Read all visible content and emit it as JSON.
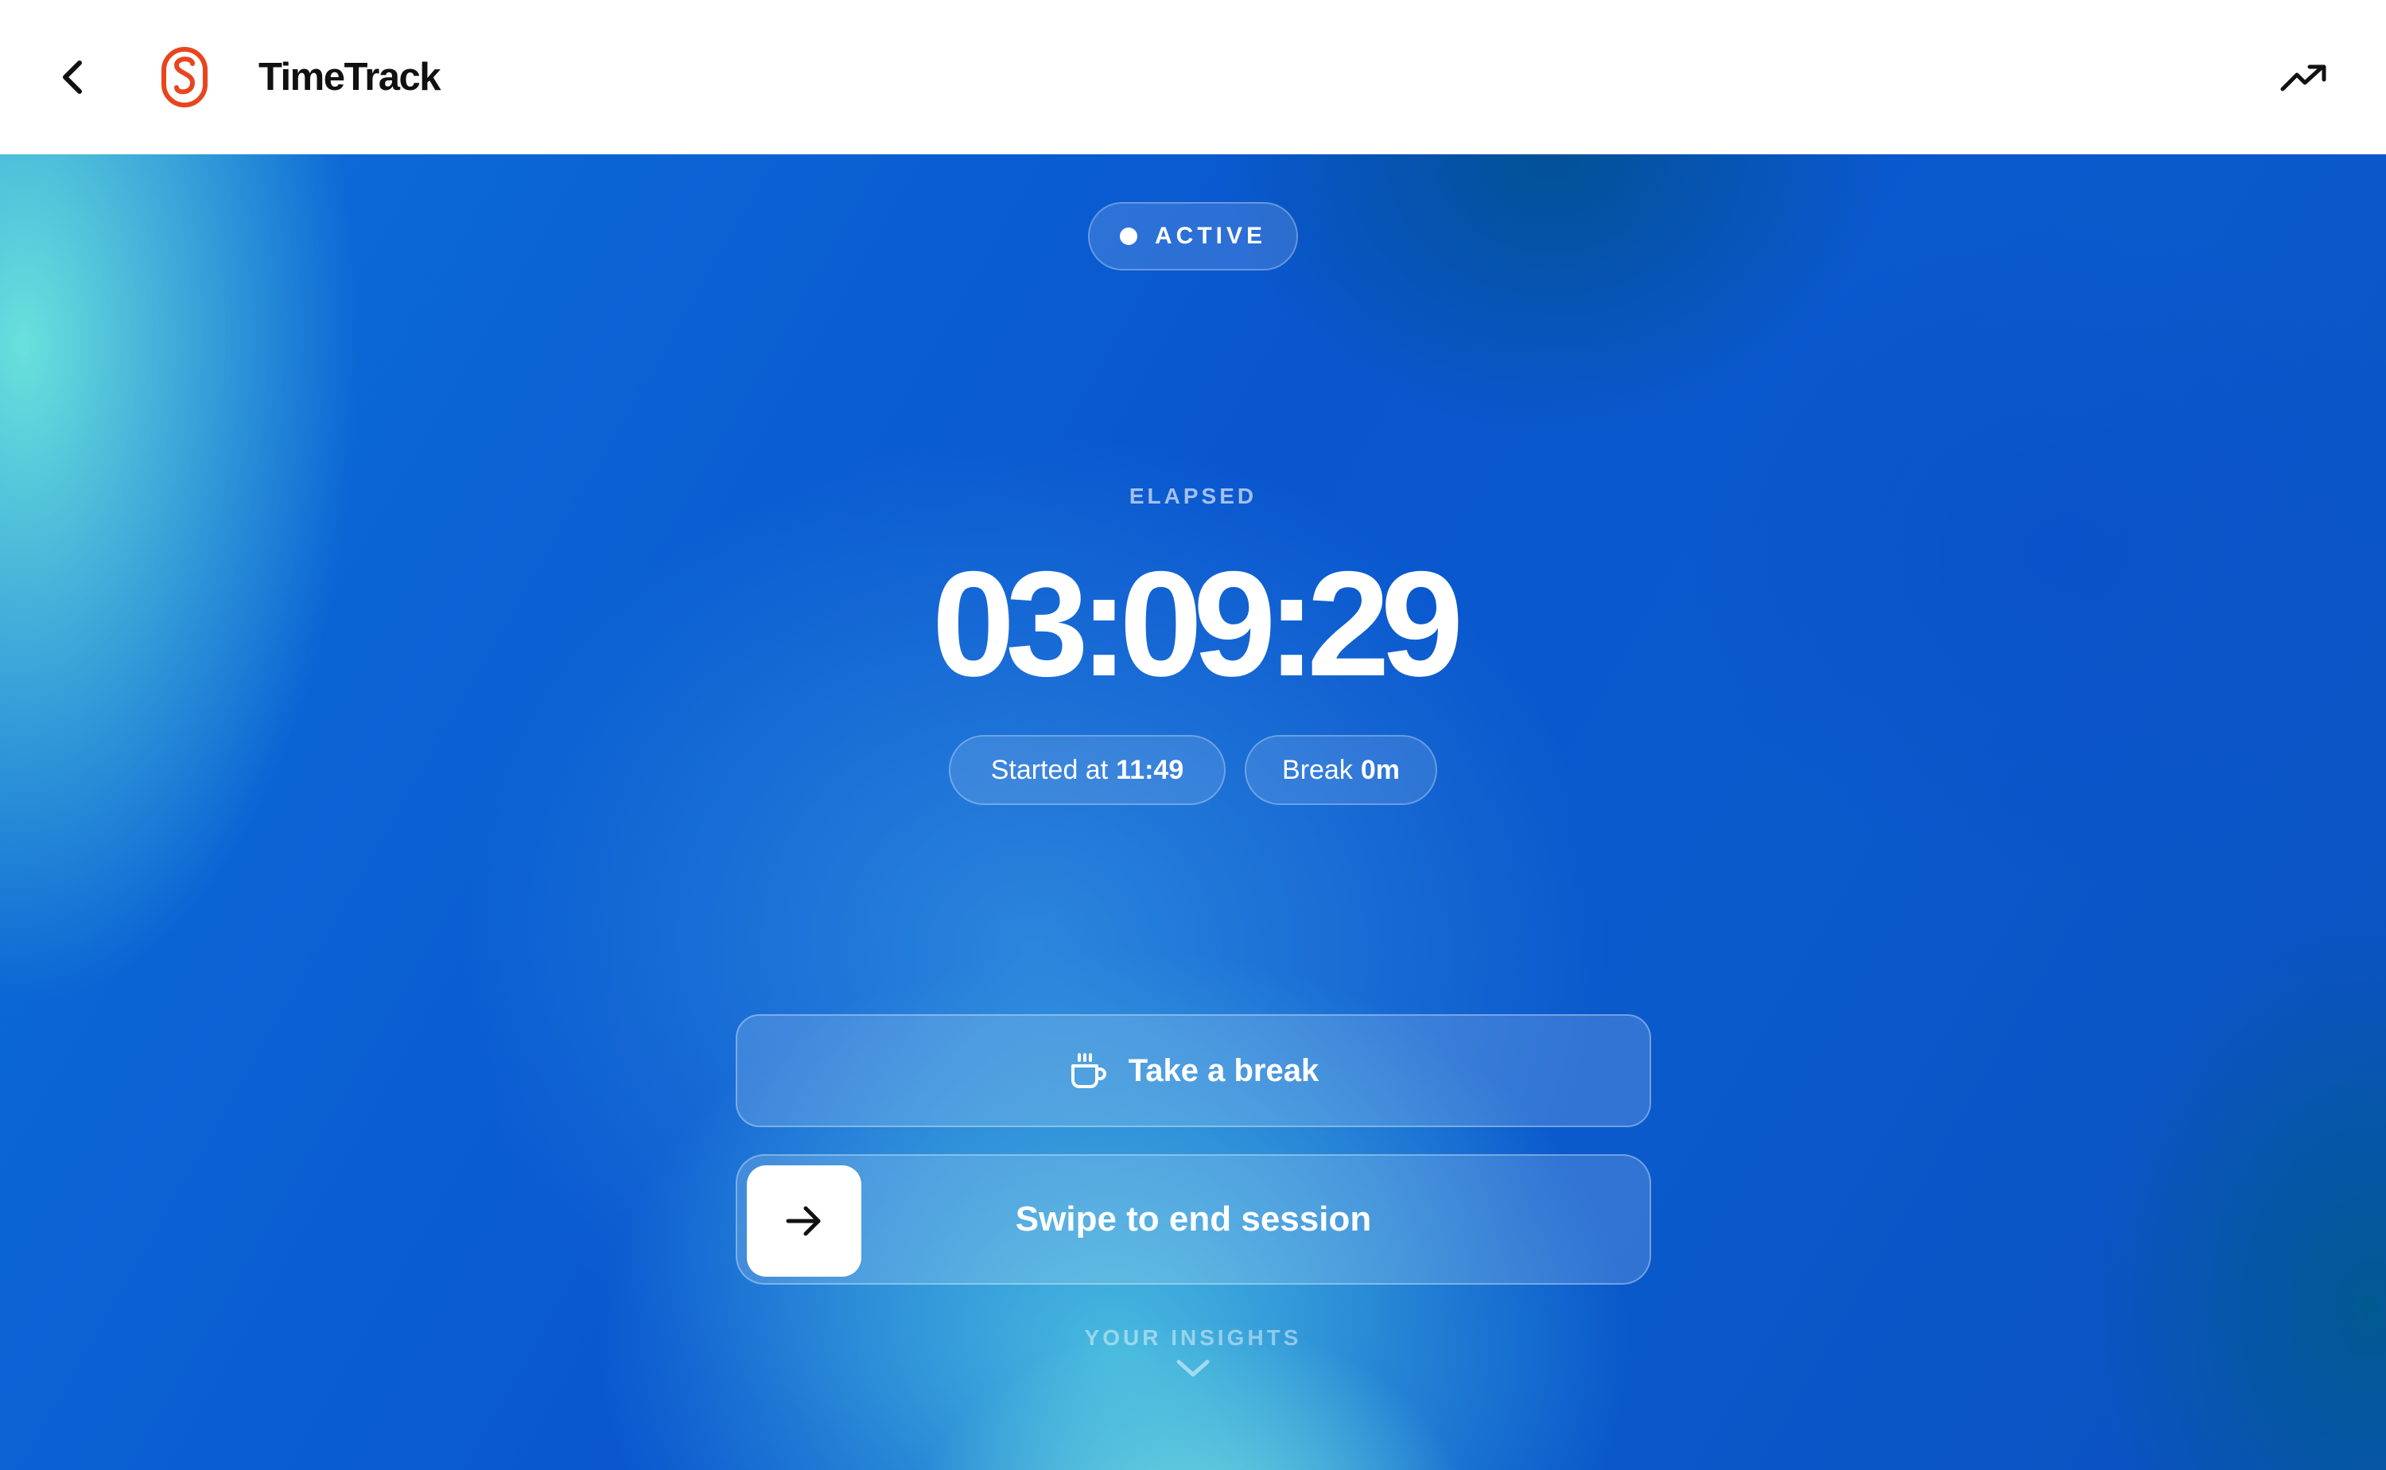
{
  "header": {
    "app_title": "TimeTrack",
    "back_icon": "chevron-left-icon",
    "trend_icon": "trending-up-icon",
    "logo_color": "#E8451E"
  },
  "session": {
    "status": "ACTIVE",
    "elapsed_label": "ELAPSED",
    "elapsed_time": "03:09:29",
    "started_label": "Started at",
    "started_time": "11:49",
    "break_label": "Break",
    "break_value": "0m"
  },
  "actions": {
    "take_break_label": "Take a break",
    "take_break_icon": "coffee-cup-icon",
    "swipe_label": "Swipe to end session",
    "swipe_icon": "arrow-right-icon"
  },
  "insights": {
    "label": "YOUR INSIGHTS",
    "icon": "chevron-down-icon"
  },
  "colors": {
    "accent": "#E8451E",
    "background_primary": "#0A56CF",
    "background_highlight": "#69E1DC"
  }
}
